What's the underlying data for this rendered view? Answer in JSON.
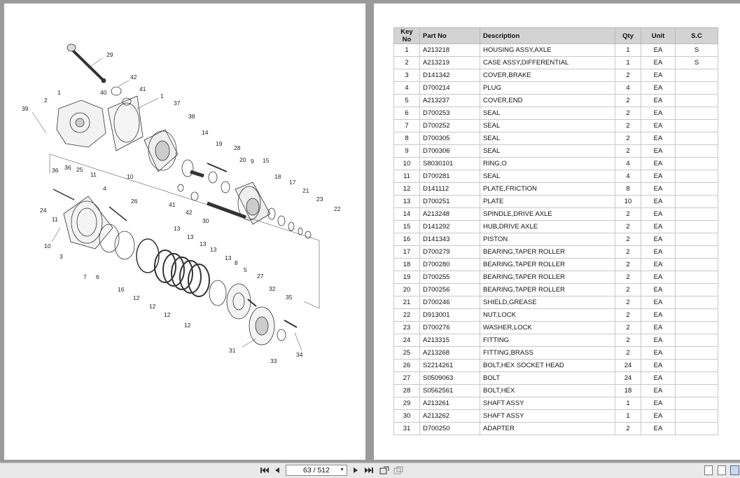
{
  "viewer": {
    "current_page": "63 / 512",
    "icons": [
      "first-page-icon",
      "prev-page-icon",
      "next-page-icon",
      "last-page-icon",
      "rotate-icon",
      "fit-icon",
      "single-page-icon",
      "continuous-icon",
      "two-page-icon"
    ]
  },
  "diagram": {
    "callouts": [
      "29",
      "42",
      "41",
      "1",
      "40",
      "2",
      "1",
      "37",
      "39",
      "38",
      "14",
      "19",
      "28",
      "20",
      "9",
      "15",
      "10",
      "36",
      "36",
      "25",
      "11",
      "4",
      "18",
      "17",
      "21",
      "23",
      "22",
      "26",
      "24",
      "41",
      "42",
      "30",
      "11",
      "10",
      "3",
      "7",
      "6",
      "16",
      "13",
      "13",
      "13",
      "13",
      "13",
      "8",
      "12",
      "12",
      "12",
      "5",
      "27",
      "32",
      "12",
      "35",
      "31",
      "33",
      "34"
    ]
  },
  "table": {
    "headers": [
      "Key No",
      "Part No",
      "Description",
      "Qty",
      "Unit",
      "S.C"
    ],
    "rows": [
      [
        "1",
        "A213218",
        "HOUSING ASSY,AXLE",
        "1",
        "EA",
        "S"
      ],
      [
        "2",
        "A213219",
        "CASE ASSY,DIFFERENTIAL",
        "1",
        "EA",
        "S"
      ],
      [
        "3",
        "D141342",
        "COVER,BRAKE",
        "2",
        "EA",
        ""
      ],
      [
        "4",
        "D700214",
        "PLUG",
        "4",
        "EA",
        ""
      ],
      [
        "5",
        "A213237",
        "COVER,END",
        "2",
        "EA",
        ""
      ],
      [
        "6",
        "D700253",
        "SEAL",
        "2",
        "EA",
        ""
      ],
      [
        "7",
        "D700252",
        "SEAL",
        "2",
        "EA",
        ""
      ],
      [
        "8",
        "D700305",
        "SEAL",
        "2",
        "EA",
        ""
      ],
      [
        "9",
        "D700306",
        "SEAL",
        "2",
        "EA",
        ""
      ],
      [
        "10",
        "S8030101",
        "RING,O",
        "4",
        "EA",
        ""
      ],
      [
        "11",
        "D700281",
        "SEAL",
        "4",
        "EA",
        ""
      ],
      [
        "12",
        "D141112",
        "PLATE,FRICTION",
        "8",
        "EA",
        ""
      ],
      [
        "13",
        "D700251",
        "PLATE",
        "10",
        "EA",
        ""
      ],
      [
        "14",
        "A213248",
        "SPINDLE,DRIVE AXLE",
        "2",
        "EA",
        ""
      ],
      [
        "15",
        "D141292",
        "HUB,DRIVE AXLE",
        "2",
        "EA",
        ""
      ],
      [
        "16",
        "D141343",
        "PISTON",
        "2",
        "EA",
        ""
      ],
      [
        "17",
        "D700279",
        "BEARING,TAPER ROLLER",
        "2",
        "EA",
        ""
      ],
      [
        "18",
        "D700280",
        "BEARING,TAPER ROLLER",
        "2",
        "EA",
        ""
      ],
      [
        "19",
        "D700255",
        "BEARING,TAPER ROLLER",
        "2",
        "EA",
        ""
      ],
      [
        "20",
        "D700256",
        "BEARING,TAPER ROLLER",
        "2",
        "EA",
        ""
      ],
      [
        "21",
        "D700246",
        "SHIELD,GREASE",
        "2",
        "EA",
        ""
      ],
      [
        "22",
        "D913001",
        "NUT,LOCK",
        "2",
        "EA",
        ""
      ],
      [
        "23",
        "D700276",
        "WASHER,LOCK",
        "2",
        "EA",
        ""
      ],
      [
        "24",
        "A213315",
        "FITTING",
        "2",
        "EA",
        ""
      ],
      [
        "25",
        "A213268",
        "FITTING,BRASS",
        "2",
        "EA",
        ""
      ],
      [
        "26",
        "S2214261",
        "BOLT,HEX SOCKET HEAD",
        "24",
        "EA",
        ""
      ],
      [
        "27",
        "S0509063",
        "BOLT",
        "24",
        "EA",
        ""
      ],
      [
        "28",
        "S0562561",
        "BOLT,HEX",
        "18",
        "EA",
        ""
      ],
      [
        "29",
        "A213261",
        "SHAFT ASSY",
        "1",
        "EA",
        ""
      ],
      [
        "30",
        "A213262",
        "SHAFT ASSY",
        "1",
        "EA",
        ""
      ],
      [
        "31",
        "D700250",
        "ADAPTER",
        "2",
        "EA",
        ""
      ]
    ]
  }
}
